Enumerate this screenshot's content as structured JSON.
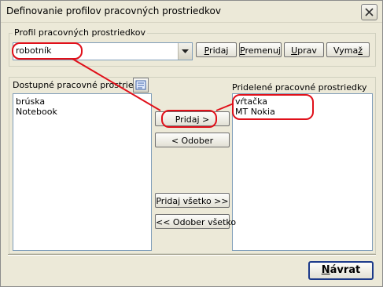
{
  "window": {
    "title": "Definovanie profilov pracovných prostriedkov"
  },
  "profile_group": {
    "label": "Profil pracovných prostriedkov",
    "combo_value": "robotník",
    "buttons": {
      "add": {
        "u": "P",
        "rest": "ridaj"
      },
      "rename": {
        "u": "P",
        "rest": "remenuj"
      },
      "edit": {
        "u": "U",
        "rest": "prav"
      },
      "delete": {
        "pre": "Vyma",
        "u": "ž"
      }
    }
  },
  "available": {
    "label": "Dostupné pracovné prostriedky",
    "items": [
      "brúska",
      "Notebook"
    ]
  },
  "assigned": {
    "label": "Pridelené pracovné prostriedky",
    "items": [
      "vŕtačka",
      "MT Nokia"
    ]
  },
  "transfer": {
    "add": "Pridaj >",
    "remove": "< Odober",
    "add_all": "Pridaj všetko >>",
    "remove_all": "<< Odober všetko"
  },
  "footer": {
    "back_u": "N",
    "back_rest": "ávrat"
  },
  "colors": {
    "annotation": "#e0101a",
    "face": "#ece9d8"
  }
}
